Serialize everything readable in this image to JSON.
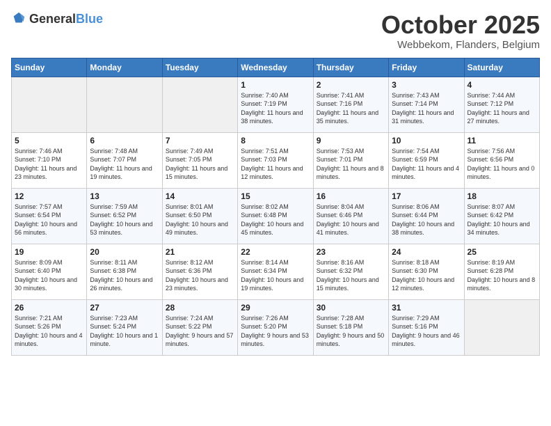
{
  "header": {
    "logo_general": "General",
    "logo_blue": "Blue",
    "title": "October 2025",
    "subtitle": "Webbekom, Flanders, Belgium"
  },
  "weekdays": [
    "Sunday",
    "Monday",
    "Tuesday",
    "Wednesday",
    "Thursday",
    "Friday",
    "Saturday"
  ],
  "weeks": [
    [
      {
        "day": "",
        "info": ""
      },
      {
        "day": "",
        "info": ""
      },
      {
        "day": "",
        "info": ""
      },
      {
        "day": "1",
        "info": "Sunrise: 7:40 AM\nSunset: 7:19 PM\nDaylight: 11 hours\nand 38 minutes."
      },
      {
        "day": "2",
        "info": "Sunrise: 7:41 AM\nSunset: 7:16 PM\nDaylight: 11 hours\nand 35 minutes."
      },
      {
        "day": "3",
        "info": "Sunrise: 7:43 AM\nSunset: 7:14 PM\nDaylight: 11 hours\nand 31 minutes."
      },
      {
        "day": "4",
        "info": "Sunrise: 7:44 AM\nSunset: 7:12 PM\nDaylight: 11 hours\nand 27 minutes."
      }
    ],
    [
      {
        "day": "5",
        "info": "Sunrise: 7:46 AM\nSunset: 7:10 PM\nDaylight: 11 hours\nand 23 minutes."
      },
      {
        "day": "6",
        "info": "Sunrise: 7:48 AM\nSunset: 7:07 PM\nDaylight: 11 hours\nand 19 minutes."
      },
      {
        "day": "7",
        "info": "Sunrise: 7:49 AM\nSunset: 7:05 PM\nDaylight: 11 hours\nand 15 minutes."
      },
      {
        "day": "8",
        "info": "Sunrise: 7:51 AM\nSunset: 7:03 PM\nDaylight: 11 hours\nand 12 minutes."
      },
      {
        "day": "9",
        "info": "Sunrise: 7:53 AM\nSunset: 7:01 PM\nDaylight: 11 hours\nand 8 minutes."
      },
      {
        "day": "10",
        "info": "Sunrise: 7:54 AM\nSunset: 6:59 PM\nDaylight: 11 hours\nand 4 minutes."
      },
      {
        "day": "11",
        "info": "Sunrise: 7:56 AM\nSunset: 6:56 PM\nDaylight: 11 hours\nand 0 minutes."
      }
    ],
    [
      {
        "day": "12",
        "info": "Sunrise: 7:57 AM\nSunset: 6:54 PM\nDaylight: 10 hours\nand 56 minutes."
      },
      {
        "day": "13",
        "info": "Sunrise: 7:59 AM\nSunset: 6:52 PM\nDaylight: 10 hours\nand 53 minutes."
      },
      {
        "day": "14",
        "info": "Sunrise: 8:01 AM\nSunset: 6:50 PM\nDaylight: 10 hours\nand 49 minutes."
      },
      {
        "day": "15",
        "info": "Sunrise: 8:02 AM\nSunset: 6:48 PM\nDaylight: 10 hours\nand 45 minutes."
      },
      {
        "day": "16",
        "info": "Sunrise: 8:04 AM\nSunset: 6:46 PM\nDaylight: 10 hours\nand 41 minutes."
      },
      {
        "day": "17",
        "info": "Sunrise: 8:06 AM\nSunset: 6:44 PM\nDaylight: 10 hours\nand 38 minutes."
      },
      {
        "day": "18",
        "info": "Sunrise: 8:07 AM\nSunset: 6:42 PM\nDaylight: 10 hours\nand 34 minutes."
      }
    ],
    [
      {
        "day": "19",
        "info": "Sunrise: 8:09 AM\nSunset: 6:40 PM\nDaylight: 10 hours\nand 30 minutes."
      },
      {
        "day": "20",
        "info": "Sunrise: 8:11 AM\nSunset: 6:38 PM\nDaylight: 10 hours\nand 26 minutes."
      },
      {
        "day": "21",
        "info": "Sunrise: 8:12 AM\nSunset: 6:36 PM\nDaylight: 10 hours\nand 23 minutes."
      },
      {
        "day": "22",
        "info": "Sunrise: 8:14 AM\nSunset: 6:34 PM\nDaylight: 10 hours\nand 19 minutes."
      },
      {
        "day": "23",
        "info": "Sunrise: 8:16 AM\nSunset: 6:32 PM\nDaylight: 10 hours\nand 15 minutes."
      },
      {
        "day": "24",
        "info": "Sunrise: 8:18 AM\nSunset: 6:30 PM\nDaylight: 10 hours\nand 12 minutes."
      },
      {
        "day": "25",
        "info": "Sunrise: 8:19 AM\nSunset: 6:28 PM\nDaylight: 10 hours\nand 8 minutes."
      }
    ],
    [
      {
        "day": "26",
        "info": "Sunrise: 7:21 AM\nSunset: 5:26 PM\nDaylight: 10 hours\nand 4 minutes."
      },
      {
        "day": "27",
        "info": "Sunrise: 7:23 AM\nSunset: 5:24 PM\nDaylight: 10 hours\nand 1 minute."
      },
      {
        "day": "28",
        "info": "Sunrise: 7:24 AM\nSunset: 5:22 PM\nDaylight: 9 hours\nand 57 minutes."
      },
      {
        "day": "29",
        "info": "Sunrise: 7:26 AM\nSunset: 5:20 PM\nDaylight: 9 hours\nand 53 minutes."
      },
      {
        "day": "30",
        "info": "Sunrise: 7:28 AM\nSunset: 5:18 PM\nDaylight: 9 hours\nand 50 minutes."
      },
      {
        "day": "31",
        "info": "Sunrise: 7:29 AM\nSunset: 5:16 PM\nDaylight: 9 hours\nand 46 minutes."
      },
      {
        "day": "",
        "info": ""
      }
    ]
  ]
}
